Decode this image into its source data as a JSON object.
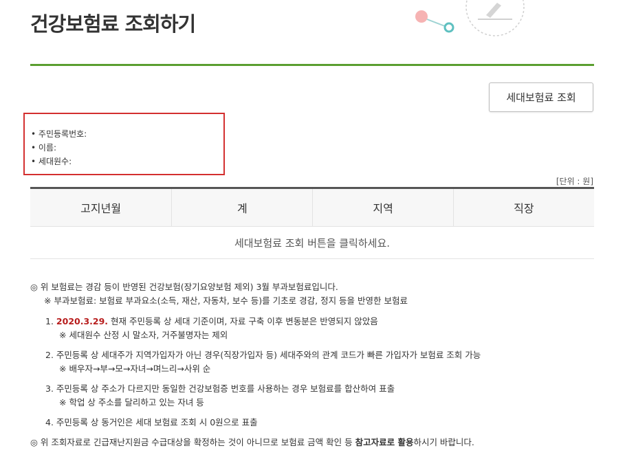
{
  "page": {
    "title": "건강보험료 조회하기"
  },
  "actions": {
    "query_button": "세대보험료 조회"
  },
  "info": {
    "items": [
      "주민등록번호:",
      "이름:",
      "세대원수:"
    ]
  },
  "table": {
    "unit": "[단위 : 원]",
    "headers": [
      "고지년월",
      "계",
      "지역",
      "직장"
    ],
    "empty_message": "세대보험료 조회 버튼을 클릭하세요."
  },
  "notes": {
    "main1": "◎ 위 보험료는 경감 등이 반영된 건강보험(장기요양보험 제외) 3월 부과보험료입니다.",
    "sub1": "※ 부과보험료: 보험료 부과요소(소득, 재산, 자동차, 보수 등)를 기초로 경감, 정지 등을 반영한 보험료",
    "item1_num": "1.",
    "item1_date": "2020.3.29.",
    "item1_text": " 현재 주민등록 상 세대 기준이며, 자료 구축 이후 변동분은 반영되지 않았음",
    "item1_sub": "※ 세대원수 산정 시 말소자, 거주불명자는 제외",
    "item2": "2. 주민등록 상 세대주가 지역가입자가 아닌 경우(직장가입자 등) 세대주와의 관계 코드가 빠른 가입자가 보험료 조회 가능",
    "item2_sub": "※ 배우자→부→모→자녀→며느리→사위 순",
    "item3": "3. 주민등록 상 주소가 다르지만 동일한 건강보험증 번호를 사용하는 경우 보험료를 합산하여 표출",
    "item3_sub": "※ 학업 상 주소를 달리하고 있는 자녀 등",
    "item4": "4. 주민등록 상 동거인은 세대 보험료 조회 시 0원으로 표출",
    "main2_a": "◎ 위 조회자료로 긴급재난지원금 수급대상을 확정하는 것이 아니므로 보험료 금액 확인 등 ",
    "main2_b": "참고자료로 활용",
    "main2_c": "하시기 바랍니다."
  },
  "colors": {
    "accent_green": "#5a9e2f",
    "highlight_red": "#d32f2f",
    "date_red": "#b71c1c"
  }
}
